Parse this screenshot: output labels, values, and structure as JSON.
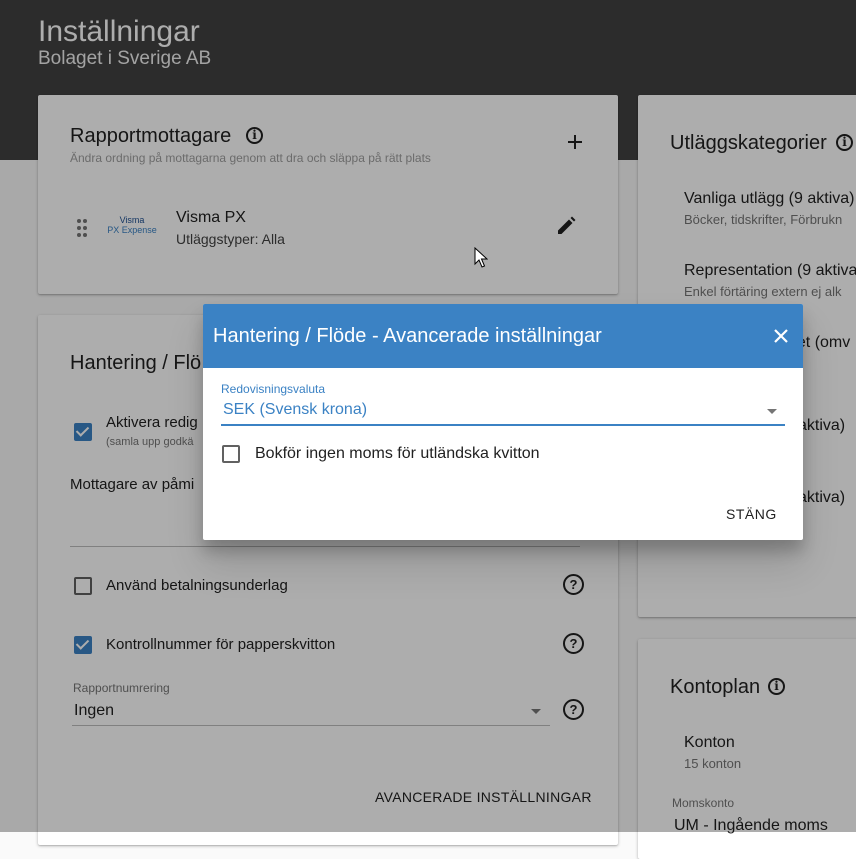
{
  "header": {
    "title": "Inställningar",
    "subtitle": "Bolaget i Sverige AB"
  },
  "report_recipients": {
    "title": "Rapportmottagare",
    "hint": "Ändra ordning på mottagarna genom att dra och släppa på rätt plats",
    "recipient": {
      "logo_line1": "Visma",
      "logo_line2": "PX Expense",
      "name": "Visma PX",
      "detail": "Utläggstyper: Alla"
    }
  },
  "handling": {
    "title": "Hantering / Flö",
    "activate_label": "Aktivera redig",
    "activate_sub": "(samla upp godkä",
    "reminder_label": "Mottagare av påmi",
    "payment_basis_label": "Använd betalningsunderlag",
    "control_number_label": "Kontrollnummer för papperskvitton",
    "report_numbering_label": "Rapportnumrering",
    "report_numbering_value": "Ingen",
    "advanced_button": "AVANCERADE INSTÄLLNINGAR"
  },
  "expense_categories": {
    "title": "Utläggskategorier",
    "items": [
      {
        "name": "Vanliga utlägg (9 aktiva)",
        "desc": "Böcker, tidskrifter, Förbrukn"
      },
      {
        "name": "Representation (9 aktiva",
        "desc": "Enkel förtäring extern ej alk"
      },
      {
        "name": "det (omv",
        "desc": ""
      },
      {
        "name": "aktiva)",
        "desc": ""
      },
      {
        "name": "aktiva)",
        "desc": ""
      }
    ]
  },
  "chart_of_accounts": {
    "title": "Kontoplan",
    "accounts_label": "Konton",
    "accounts_count": "15 konton",
    "vat_account_label": "Momskonto",
    "vat_account_value": "UM - Ingående moms"
  },
  "dialog": {
    "title": "Hantering / Flöde - Avancerade inställningar",
    "currency_label": "Redovisningsvaluta",
    "currency_value": "SEK (Svensk krona)",
    "no_vat_label": "Bokför ingen moms för utländska kvitton",
    "close_button": "STÄNG"
  },
  "colors": {
    "primary": "#3b82c4",
    "header_bg": "#424242"
  }
}
